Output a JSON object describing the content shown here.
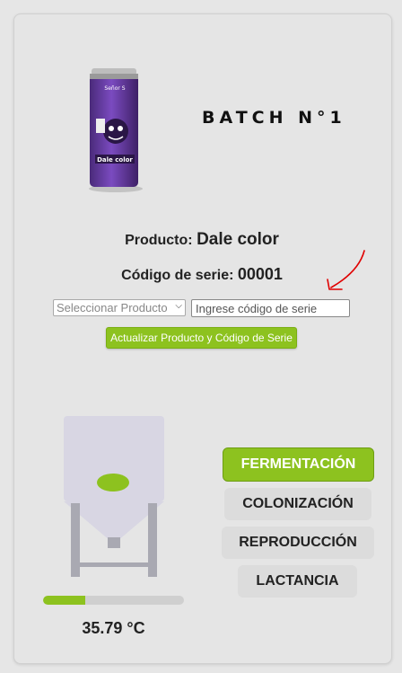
{
  "batch": {
    "title": "BATCH N°1"
  },
  "product": {
    "label": "Producto:",
    "value": "Dale color"
  },
  "serial": {
    "label": "Código de serie:",
    "value": "00001"
  },
  "form": {
    "select_value": "Seleccionar Producto",
    "serial_placeholder": "Ingrese código de serie",
    "update_label": "Actualizar Producto y Código de Serie"
  },
  "can_label": {
    "brand": "Señor S",
    "name": "Dale color"
  },
  "tank": {
    "progress": 0.3,
    "temperature": "35.79 °C"
  },
  "stages": [
    {
      "label": "FERMENTACIÓN",
      "active": true
    },
    {
      "label": "COLONIZACIÓN",
      "active": false
    },
    {
      "label": "REPRODUCCIÓN",
      "active": false
    },
    {
      "label": "LACTANCIA",
      "active": false
    }
  ],
  "colors": {
    "accent": "#8dc21f",
    "annotation": "#e00000",
    "tank_body": "#d8d6e3",
    "tank_legs": "#a9a9b2"
  }
}
